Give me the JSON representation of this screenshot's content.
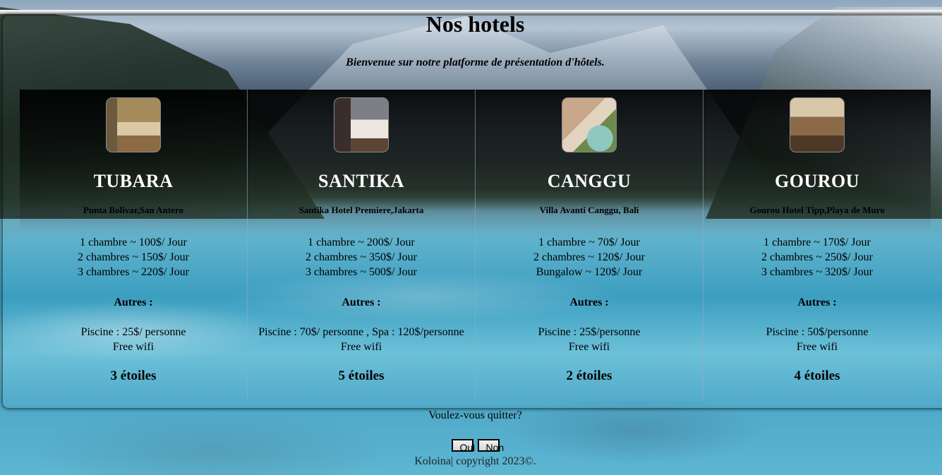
{
  "page": {
    "title": "Nos hotels",
    "subtitle": "Bienvenue sur notre platforme de présentation d'hôtels."
  },
  "hotels": [
    {
      "name": "TUBARA",
      "location": "Punta Bolivar,San Antero",
      "rooms": [
        "1 chambre ~ 100$/ Jour",
        "2 chambres ~ 150$/ Jour",
        "3 chambres ~ 220$/ Jour"
      ],
      "others_title": "Autres :",
      "extras": [
        "Piscine : 25$/ personne",
        "Free wifi"
      ],
      "stars": "3 étoiles"
    },
    {
      "name": "SANTIKA",
      "location": "Santika Hotel Premiere,Jakarta",
      "rooms": [
        "1 chambre ~ 200$/ Jour",
        "2 chambres ~ 350$/ Jour",
        "3 chambres ~ 500$/ Jour"
      ],
      "others_title": "Autres :",
      "extras": [
        "Piscine : 70$/ personne , Spa : 120$/personne",
        "Free wifi"
      ],
      "stars": "5 étoiles"
    },
    {
      "name": "CANGGU",
      "location": "Villa Avanti Canggu, Bali",
      "rooms": [
        "1 chambre ~ 70$/ Jour",
        "2 chambres ~ 120$/ Jour",
        "Bungalow ~ 120$/ Jour"
      ],
      "others_title": "Autres :",
      "extras": [
        "Piscine : 25$/personne",
        "Free wifi"
      ],
      "stars": "2 étoiles"
    },
    {
      "name": "GOUROU",
      "location": "Gourou Hotel Tipp,Playa de Muro",
      "rooms": [
        "1 chambre ~ 170$/ Jour",
        "2 chambres ~ 250$/ Jour",
        "3 chambres ~ 320$/ Jour"
      ],
      "others_title": "Autres :",
      "extras": [
        "Piscine : 50$/personne",
        "Free wifi"
      ],
      "stars": "4 étoiles"
    }
  ],
  "quit": {
    "question": "Voulez-vous quitter?",
    "yes_label": "Oui",
    "no_label": "Non"
  },
  "footer": {
    "text": "Koloina| copyright 2023©."
  }
}
